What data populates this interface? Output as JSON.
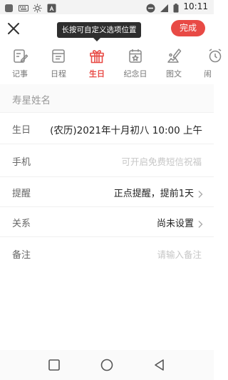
{
  "status_bar": {
    "time": "10:11",
    "icons": [
      "app-icon",
      "keyboard-icon",
      "brightness-icon",
      "a-icon",
      "do-not-disturb-icon",
      "signal-icon",
      "battery-icon"
    ]
  },
  "header": {
    "close_icon": "close-icon",
    "tooltip": "长按可自定义选项位置",
    "done_label": "完成"
  },
  "tabs": [
    {
      "label": "记事",
      "icon": "note-icon",
      "active": false
    },
    {
      "label": "日程",
      "icon": "schedule-icon",
      "active": false
    },
    {
      "label": "生日",
      "icon": "gift-icon",
      "active": true
    },
    {
      "label": "纪念日",
      "icon": "anniversary-icon",
      "active": false
    },
    {
      "label": "图文",
      "icon": "pen-image-icon",
      "active": false
    },
    {
      "label": "闹",
      "icon": "alarm-icon",
      "active": false
    }
  ],
  "form": {
    "name_placeholder": "寿星姓名",
    "birthday": {
      "label": "生日",
      "value": "(农历)2021年十月初八 10:00 上午"
    },
    "phone": {
      "label": "手机",
      "placeholder": "可开启免费短信祝福"
    },
    "reminder": {
      "label": "提醒",
      "value": "正点提醒，提前1天"
    },
    "relation": {
      "label": "关系",
      "value": "尚未设置"
    },
    "note": {
      "label": "备注",
      "placeholder": "请输入备注"
    }
  },
  "nav_bar": {
    "items": [
      "square-icon",
      "circle-icon",
      "back-triangle-icon"
    ]
  },
  "colors": {
    "accent": "#e84a45",
    "text": "#222222",
    "muted": "#777777",
    "placeholder": "#c6c6c6"
  }
}
